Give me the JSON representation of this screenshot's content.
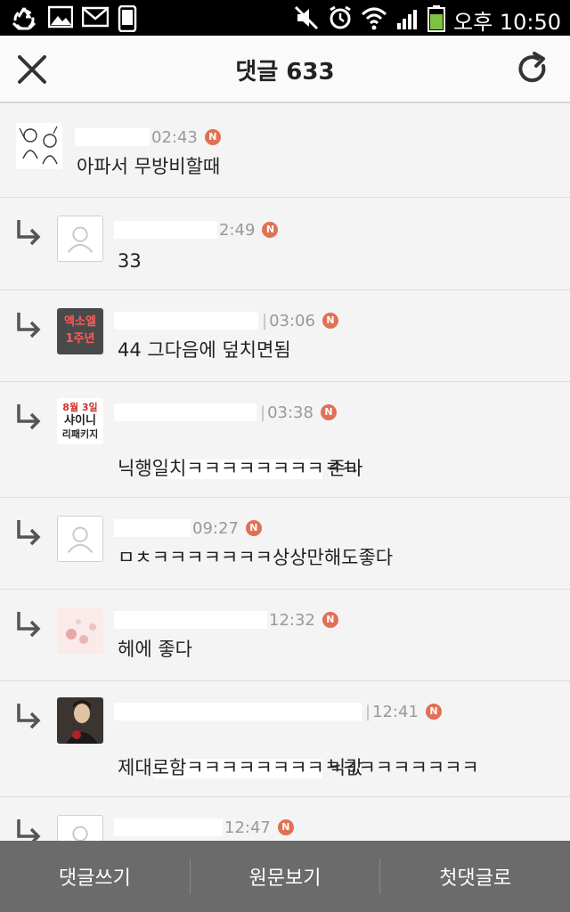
{
  "status_bar": {
    "time": "오후 10:50",
    "icons": [
      "recycle-icon",
      "image-icon",
      "gmail-icon",
      "phone-icon",
      "mute-icon",
      "alarm-icon",
      "wifi-icon",
      "signal-icon",
      "battery-icon"
    ]
  },
  "header": {
    "title": "댓글 633",
    "close_icon": "close-icon",
    "refresh_icon": "refresh-icon"
  },
  "comments": [
    {
      "time": "02:43",
      "badge": "N",
      "text": "아파서 무방비할때",
      "is_reply": false,
      "avatar": "sketch"
    },
    {
      "time": "2:49",
      "badge": "N",
      "text": "33",
      "is_reply": true,
      "avatar": "default"
    },
    {
      "time": "03:06",
      "badge": "N",
      "text": "44 그다음에 덮치면됨",
      "is_reply": true,
      "avatar": "exo"
    },
    {
      "time": "03:38",
      "badge": "N",
      "text_line1": "존나",
      "text_line2": "닉행일치ㅋㅋㅋㅋㅋㅋㅋㅋㅋㅋ",
      "is_reply": true,
      "avatar": "shinee"
    },
    {
      "time": "09:27",
      "badge": "N",
      "text": "ㅁㅊㅋㅋㅋㅋㅋㅋㅋ상상만해도좋다",
      "is_reply": true,
      "avatar": "default"
    },
    {
      "time": "12:32",
      "badge": "N",
      "text": "헤에 좋다",
      "is_reply": true,
      "avatar": "pink"
    },
    {
      "time": "12:41",
      "badge": "N",
      "text_line1": "닉값",
      "text_line2": "제대로함ㅋㅋㅋㅋㅋㅋㅋㅋㅋㅋㅋㅋㅋㅋㅋㅋㅋ",
      "is_reply": true,
      "avatar": "photo"
    },
    {
      "time": "12:47",
      "badge": "N",
      "is_reply": true,
      "avatar": "default"
    }
  ],
  "exo_avatar_text": [
    "엑소엘",
    "1주년"
  ],
  "shinee_avatar_text": [
    "8월 3일",
    "샤이니",
    "리패키지"
  ],
  "bottom_bar": {
    "write_label": "댓글쓰기",
    "original_label": "원문보기",
    "first_label": "첫댓글로"
  },
  "colors": {
    "badge": "#e17055",
    "bottom_bar": "#6b6b6b",
    "header_bg": "#fafafa",
    "list_bg": "#f4f4f4"
  }
}
